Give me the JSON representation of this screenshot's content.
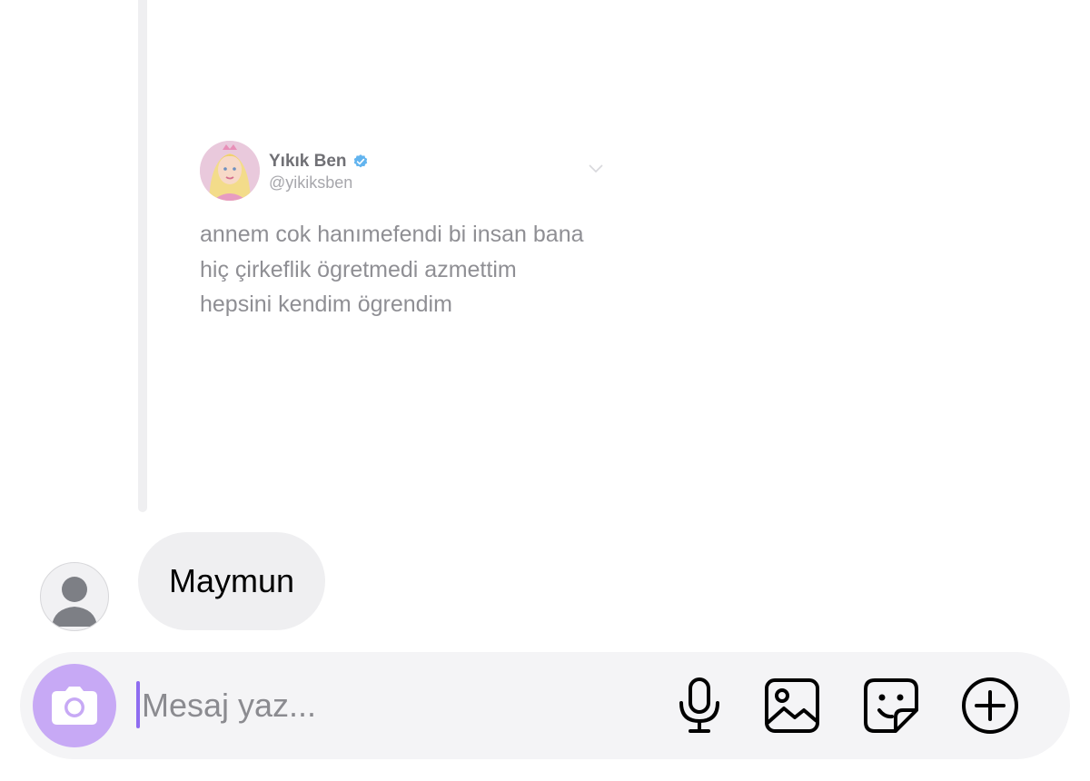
{
  "tweet": {
    "name": "Yıkık Ben",
    "handle": "@yikiksben",
    "lines": [
      "annem cok hanımefendi bi insan bana",
      "hiç çirkeflik ögretmedi azmettim",
      "hepsini kendim ögrendim"
    ]
  },
  "message": {
    "text": "Maymun"
  },
  "composer": {
    "placeholder": "Mesaj yaz...",
    "value": ""
  },
  "icons": {
    "verified": "verified-badge-icon",
    "chevron": "chevron-down-icon",
    "camera": "camera-icon",
    "mic": "microphone-icon",
    "gallery": "image-icon",
    "sticker": "sticker-icon",
    "add": "plus-circle-icon"
  },
  "colors": {
    "camera_button": "#c7a9f5",
    "cursor": "#8e6cf0",
    "verified": "#1d9bf0",
    "bubble": "#efeff1"
  }
}
